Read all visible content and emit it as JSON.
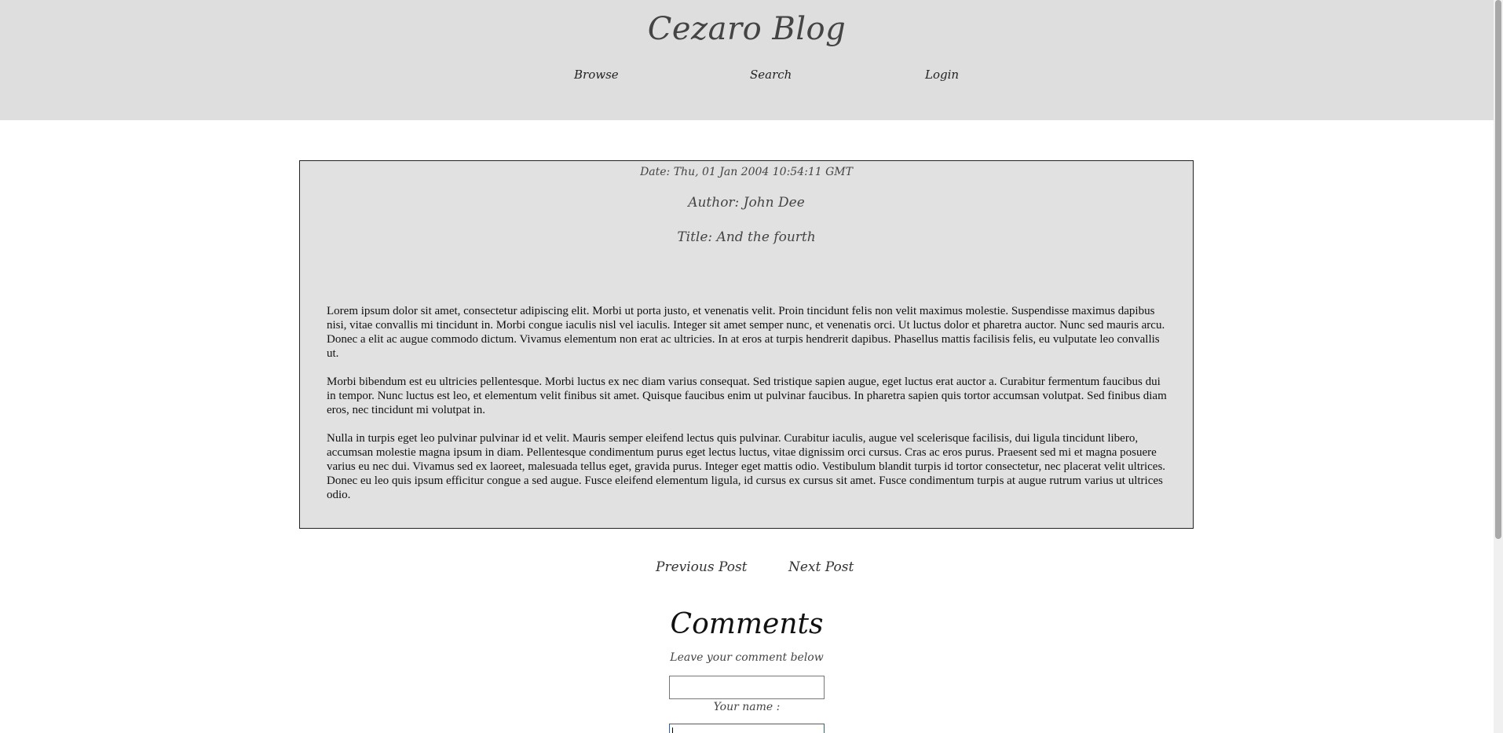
{
  "header": {
    "site_title": "Cezaro Blog",
    "nav": {
      "browse": "Browse",
      "search": "Search",
      "login": "Login"
    }
  },
  "post": {
    "date": "Date: Thu, 01 Jan 2004 10:54:11 GMT",
    "author": "Author: John Dee",
    "title": "Title: And the fourth",
    "paragraphs": [
      "Lorem ipsum dolor sit amet, consectetur adipiscing elit. Morbi ut porta justo, et venenatis velit. Proin tincidunt felis non velit maximus molestie. Suspendisse maximus dapibus nisi, vitae convallis mi tincidunt in. Morbi congue iaculis nisl vel iaculis. Integer sit amet semper nunc, et venenatis orci. Ut luctus dolor et pharetra auctor. Nunc sed mauris arcu. Donec a elit ac augue commodo dictum. Vivamus elementum non erat ac ultricies. In at eros at turpis hendrerit dapibus. Phasellus mattis facilisis felis, eu vulputate leo convallis ut.",
      "Morbi bibendum est eu ultricies pellentesque. Morbi luctus ex nec diam varius consequat. Sed tristique sapien augue, eget luctus erat auctor a. Curabitur fermentum faucibus dui in tempor. Nunc luctus est leo, et elementum velit finibus sit amet. Quisque faucibus enim ut pulvinar faucibus. In pharetra sapien quis tortor accumsan volutpat. Sed finibus diam eros, nec tincidunt mi volutpat in.",
      "Nulla in turpis eget leo pulvinar pulvinar id et velit. Mauris semper eleifend lectus quis pulvinar. Curabitur iaculis, augue vel scelerisque facilisis, dui ligula tincidunt libero, accumsan molestie magna ipsum in diam. Pellentesque condimentum purus eget lectus luctus, vitae dignissim orci cursus. Cras ac eros purus. Praesent sed mi et magna posuere varius eu nec dui. Vivamus sed ex laoreet, malesuada tellus eget, gravida purus. Integer eget mattis odio. Vestibulum blandit turpis id tortor consectetur, nec placerat velit ultrices. Donec eu leo quis ipsum efficitur congue a sed augue. Fusce eleifend elementum ligula, id cursus ex cursus sit amet. Fusce condimentum turpis at augue rutrum varius ut ultrices odio."
    ]
  },
  "post_nav": {
    "previous": "Previous Post",
    "next": "Next Post"
  },
  "comments": {
    "heading": "Comments",
    "subheading": "Leave your comment below",
    "comment_value": "",
    "name_label": "Your name :",
    "name_value": ""
  },
  "colors": {
    "header_bg": "#dedede",
    "post_bg": "#e1e1e1",
    "focus_border": "#2a5ad8"
  }
}
